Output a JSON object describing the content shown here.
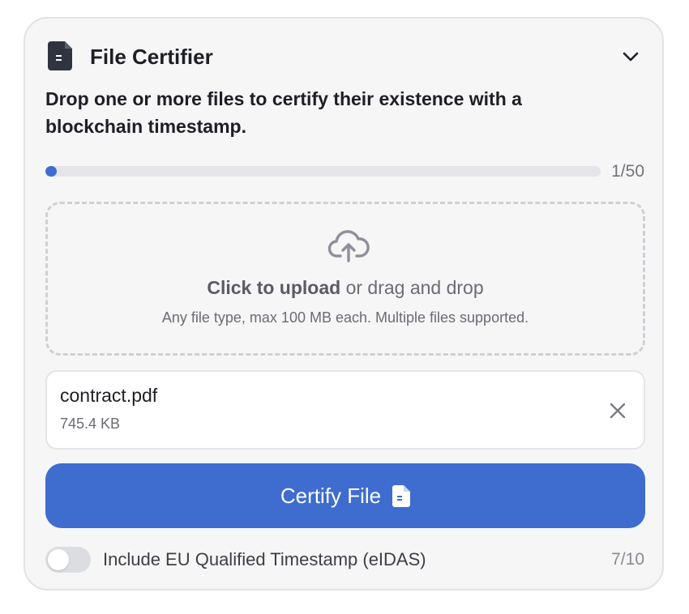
{
  "header": {
    "title": "File Certifier",
    "icon": "document-icon",
    "collapse_icon": "chevron-down-icon"
  },
  "description": "Drop one or more files to certify their existence with a blockchain timestamp.",
  "progress": {
    "current": 1,
    "max": 50,
    "label": "1/50",
    "color": "#3f6dcf"
  },
  "dropzone": {
    "icon": "cloud-upload-icon",
    "action_text": "Click to upload",
    "secondary_text": " or drag and drop",
    "hint": "Any file type, max 100 MB each. Multiple files supported."
  },
  "files": [
    {
      "name": "contract.pdf",
      "size": "745.4 KB",
      "remove_icon": "close-icon"
    }
  ],
  "certify_button": {
    "label": "Certify File",
    "icon": "document-icon",
    "color": "#3e6ccf"
  },
  "eidas": {
    "label": "Include EU Qualified Timestamp (eIDAS)",
    "enabled": false,
    "count": "7/10"
  }
}
